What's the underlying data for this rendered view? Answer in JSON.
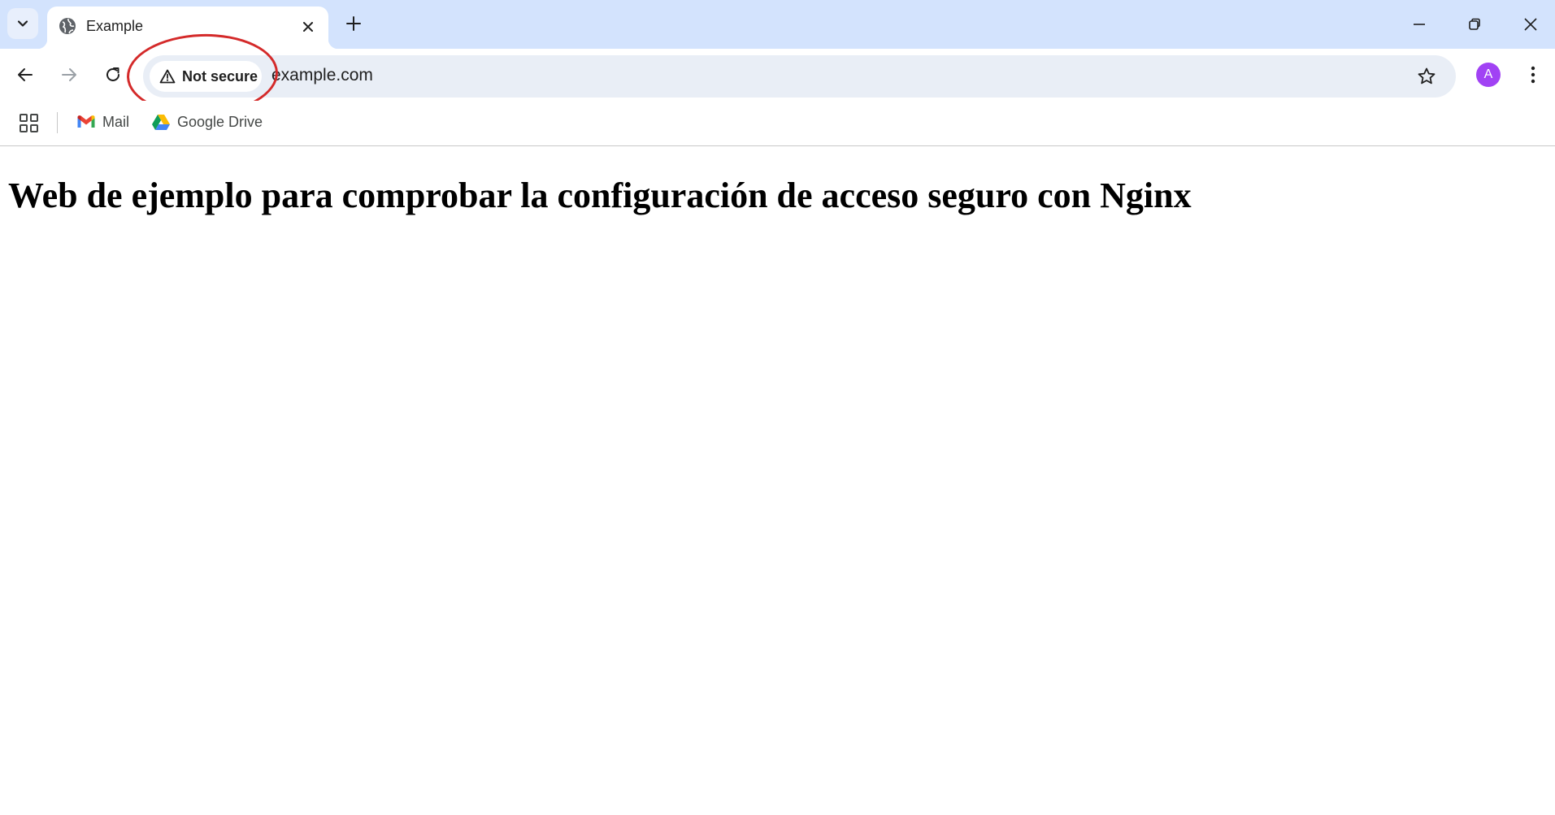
{
  "browser": {
    "tab": {
      "title": "Example"
    },
    "omnibox": {
      "security_label": "Not secure",
      "url": "example.com"
    },
    "profile": {
      "initial": "A",
      "color": "#a142f4"
    },
    "bookmarks": [
      {
        "label": "Mail",
        "icon": "gmail-icon"
      },
      {
        "label": "Google Drive",
        "icon": "google-drive-icon"
      }
    ],
    "colors": {
      "tabstrip": "#d3e3fd",
      "omnibox": "#e9eef6",
      "annotation": "#d42a2a"
    }
  },
  "page": {
    "heading": "Web de ejemplo para comprobar la configuración de acceso seguro con Nginx"
  }
}
